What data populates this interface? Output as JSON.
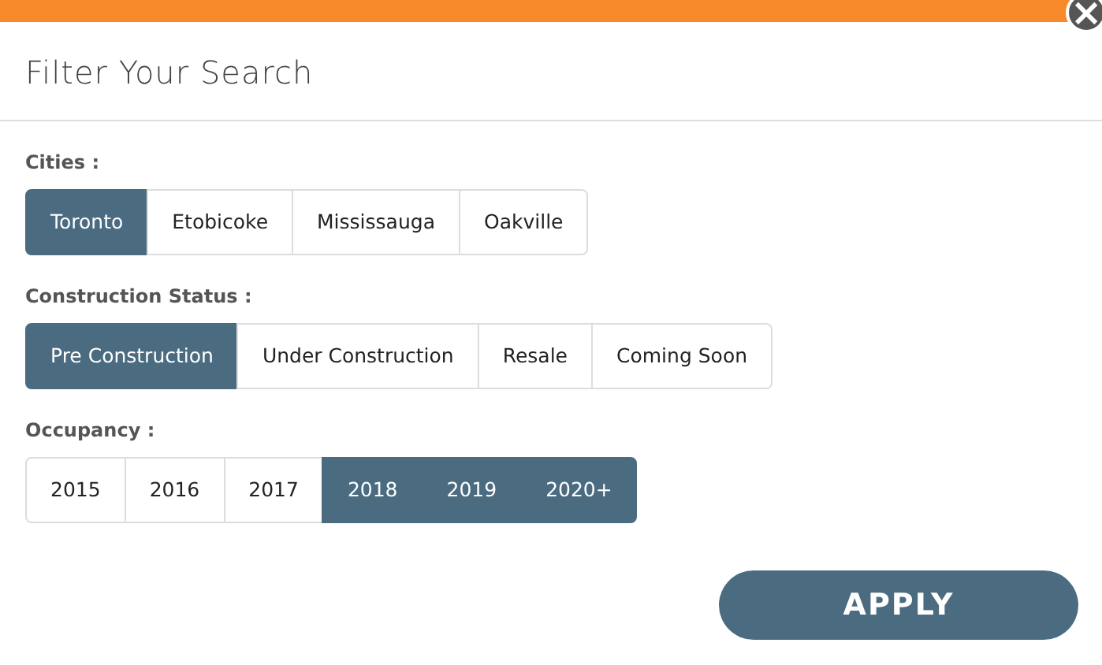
{
  "modal": {
    "title": "Filter Your Search",
    "close_button": "×"
  },
  "groups": [
    {
      "label": "Cities :",
      "options": [
        {
          "label": "Toronto",
          "selected": true
        },
        {
          "label": "Etobicoke",
          "selected": false
        },
        {
          "label": "Mississauga",
          "selected": false
        },
        {
          "label": "Oakville",
          "selected": false
        }
      ]
    },
    {
      "label": "Construction Status :",
      "options": [
        {
          "label": "Pre Construction",
          "selected": true
        },
        {
          "label": "Under Construction",
          "selected": false
        },
        {
          "label": "Resale",
          "selected": false
        },
        {
          "label": "Coming Soon",
          "selected": false
        }
      ]
    },
    {
      "label": "Occupancy :",
      "options": [
        {
          "label": "2015",
          "selected": false
        },
        {
          "label": "2016",
          "selected": false
        },
        {
          "label": "2017",
          "selected": false
        },
        {
          "label": "2018",
          "selected": true
        },
        {
          "label": "2019",
          "selected": true
        },
        {
          "label": "2020+",
          "selected": true
        }
      ]
    }
  ],
  "apply_button": "APPLY"
}
